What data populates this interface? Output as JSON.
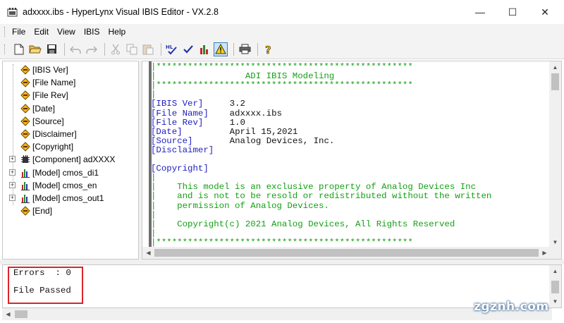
{
  "window": {
    "title": "adxxxx.ibs - HyperLynx Visual IBIS Editor - VX.2.8",
    "controls": {
      "minimize": "—",
      "maximize": "☐",
      "close": "✕"
    }
  },
  "menu": [
    "File",
    "Edit",
    "View",
    "IBIS",
    "Help"
  ],
  "toolbar": [
    {
      "name": "new-file-icon",
      "enabled": true
    },
    {
      "name": "open-folder-icon",
      "enabled": true
    },
    {
      "name": "save-icon",
      "enabled": true
    },
    {
      "name": "undo-icon",
      "enabled": false
    },
    {
      "name": "redo-icon",
      "enabled": false
    },
    {
      "name": "cut-icon",
      "enabled": false
    },
    {
      "name": "copy-icon",
      "enabled": false
    },
    {
      "name": "paste-icon",
      "enabled": false
    },
    {
      "name": "hyperlynx-check-icon",
      "enabled": true
    },
    {
      "name": "check-icon",
      "enabled": true
    },
    {
      "name": "chart-icon",
      "enabled": true
    },
    {
      "name": "warning-icon",
      "enabled": true,
      "active": true
    },
    {
      "name": "print-icon",
      "enabled": true
    },
    {
      "name": "help-icon",
      "enabled": true
    }
  ],
  "tree": {
    "items": [
      {
        "label": "[IBIS Ver]",
        "icon": "diamond-icon"
      },
      {
        "label": "[File Name]",
        "icon": "diamond-icon"
      },
      {
        "label": "[File Rev]",
        "icon": "diamond-icon"
      },
      {
        "label": "[Date]",
        "icon": "diamond-icon"
      },
      {
        "label": "[Source]",
        "icon": "diamond-icon"
      },
      {
        "label": "[Disclaimer]",
        "icon": "diamond-icon"
      },
      {
        "label": "[Copyright]",
        "icon": "diamond-icon"
      },
      {
        "label": "[Component] adXXXX",
        "icon": "component-chip-icon",
        "expander": "+"
      },
      {
        "label": "[Model] cmos_di1",
        "icon": "model-chart-icon",
        "expander": "+"
      },
      {
        "label": "[Model] cmos_en",
        "icon": "model-chart-icon",
        "expander": "+"
      },
      {
        "label": "[Model] cmos_out1",
        "icon": "model-chart-icon",
        "expander": "+"
      },
      {
        "label": "[End]",
        "icon": "diamond-icon"
      }
    ]
  },
  "editor": {
    "lines": [
      {
        "kind": "stars",
        "text": "|*************************************************"
      },
      {
        "kind": "heading",
        "text": "|                 ADI IBIS Modeling"
      },
      {
        "kind": "stars",
        "text": "|*************************************************"
      },
      {
        "kind": "blank",
        "text": "|"
      },
      {
        "kind": "kv",
        "key": "[IBIS Ver]",
        "value": "3.2"
      },
      {
        "kind": "kv",
        "key": "[File Name]",
        "value": "adxxxx.ibs"
      },
      {
        "kind": "kv",
        "key": "[File Rev]",
        "value": "1.0"
      },
      {
        "kind": "kv",
        "key": "[Date]",
        "value": "April 15,2021"
      },
      {
        "kind": "kv",
        "key": "[Source]",
        "value": "Analog Devices, Inc."
      },
      {
        "kind": "kv",
        "key": "[Disclaimer]",
        "value": ""
      },
      {
        "kind": "blank",
        "text": ""
      },
      {
        "kind": "kv",
        "key": "[Copyright]",
        "value": ""
      },
      {
        "kind": "comment",
        "text": "|"
      },
      {
        "kind": "comment",
        "text": "|    This model is an exclusive property of Analog Devices Inc"
      },
      {
        "kind": "comment",
        "text": "|    and is not to be resold or redistributed without the written"
      },
      {
        "kind": "comment",
        "text": "|    permission of Analog Devices."
      },
      {
        "kind": "comment",
        "text": "|"
      },
      {
        "kind": "comment",
        "text": "|    Copyright(c) 2021 Analog Devices, All Rights Reserved"
      },
      {
        "kind": "comment",
        "text": "|"
      },
      {
        "kind": "stars",
        "text": "|*************************************************"
      },
      {
        "kind": "stars",
        "text": "|*************************************************"
      }
    ]
  },
  "output": {
    "errors_line": "Errors  : 0",
    "status_line": "File Passed"
  },
  "watermark": "zgznh.com",
  "colors": {
    "comment_green": "#14a014",
    "keyword_blue": "#2020c0",
    "highlight_red": "#d9262a"
  }
}
